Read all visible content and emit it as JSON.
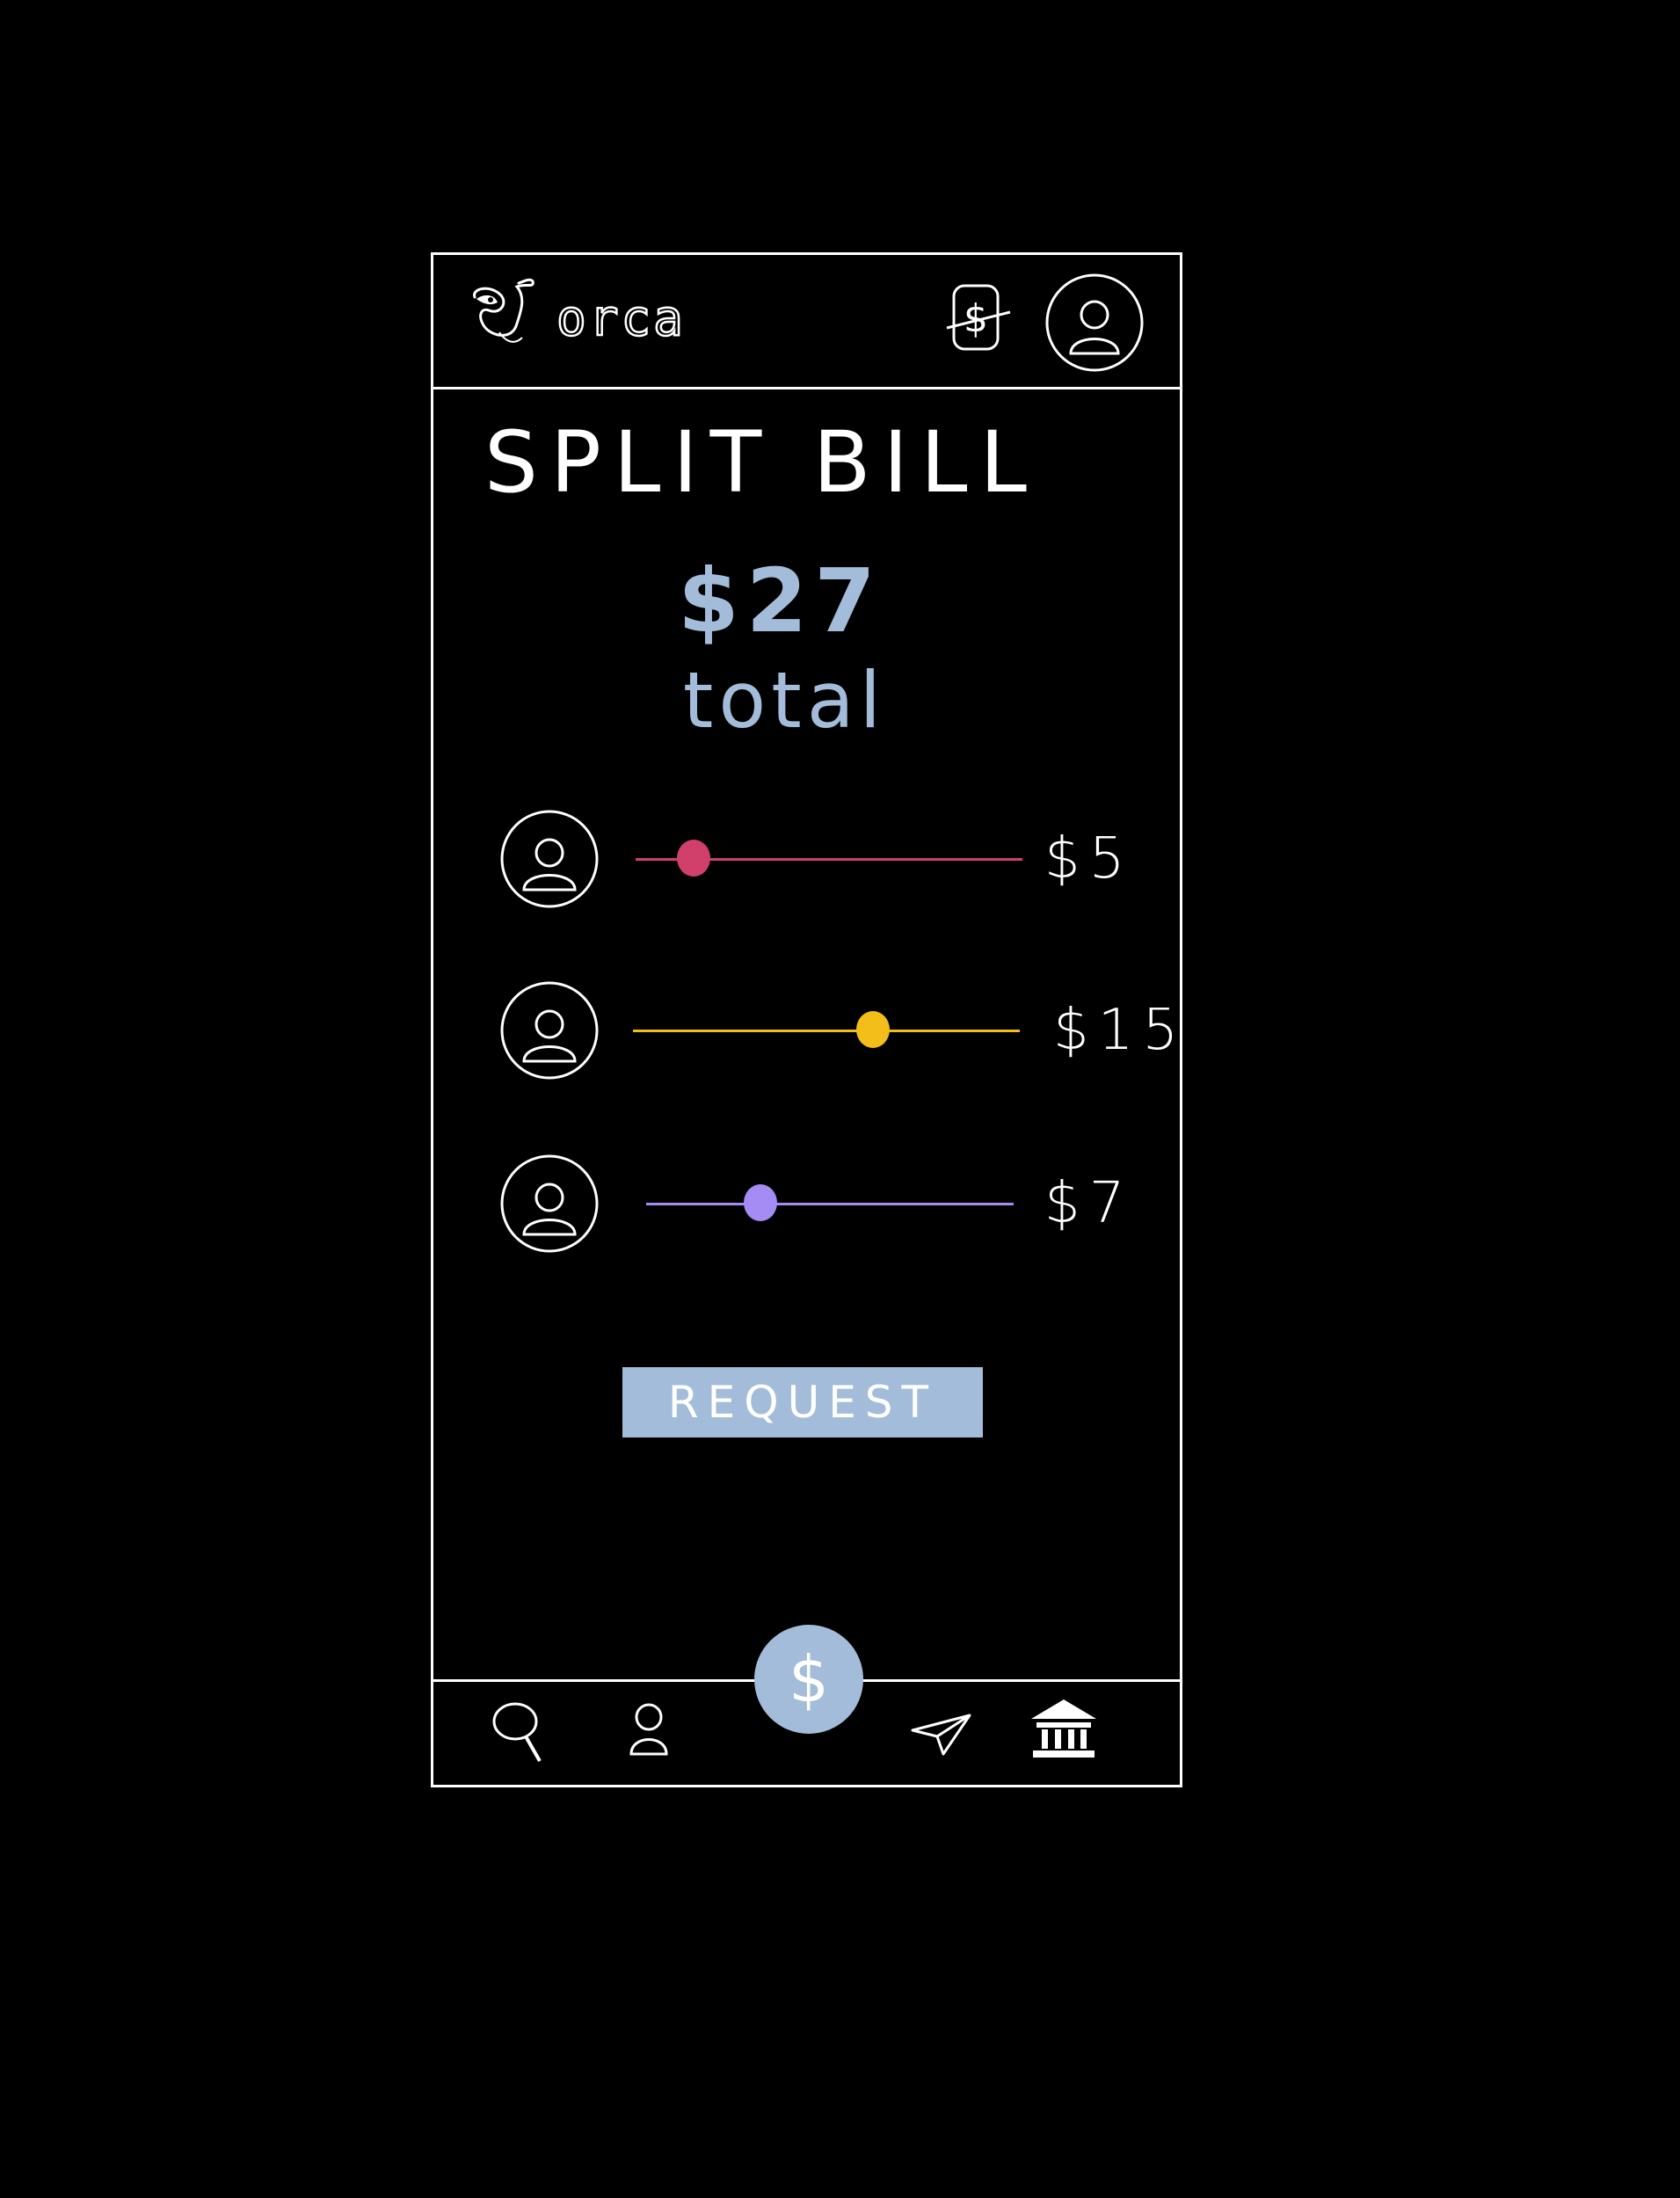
{
  "header": {
    "brand": "orca",
    "logo_icon": "orca-logo-icon",
    "wallet_icon": "dollar-card-icon",
    "profile_icon": "profile-avatar-icon"
  },
  "page": {
    "title": "SPLIT BILL",
    "total_amount": "$27",
    "total_label": "total"
  },
  "splits": [
    {
      "amount": "$5",
      "color": "#d13f6b",
      "fraction": 0.15
    },
    {
      "amount": "$15",
      "color": "#f3bd1a",
      "fraction": 0.62
    },
    {
      "amount": "$7",
      "color": "#a58cf5",
      "fraction": 0.31
    }
  ],
  "actions": {
    "request_label": "REQUEST"
  },
  "nav": {
    "items": [
      "search-icon",
      "person-icon",
      "dollar-icon",
      "send-icon",
      "bank-icon"
    ],
    "fab_symbol": "$"
  },
  "colors": {
    "accent": "#a3bcd9",
    "background": "#000000",
    "stroke": "#ffffff"
  }
}
